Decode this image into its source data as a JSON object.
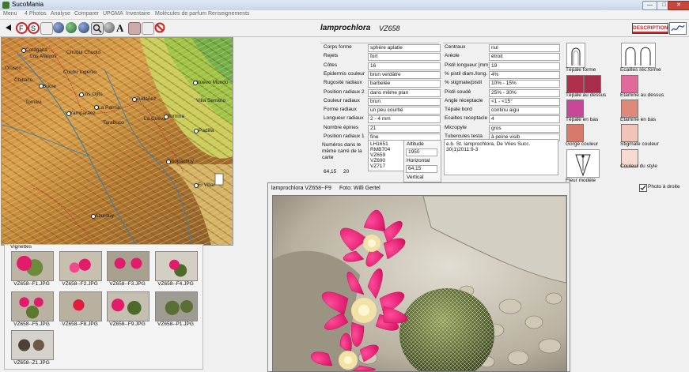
{
  "window": {
    "title": "SucoMania",
    "buttons": [
      "—",
      "□",
      "✕"
    ]
  },
  "menu": [
    "Menu",
    "4 Photos",
    "Analyse",
    "Comparer",
    "UPGMA",
    "Inventaire",
    "Molécules de parfum",
    "Renseignements"
  ],
  "header": {
    "species": "lamprochlora",
    "code": "VZ658",
    "description_button": "DESCRIPTION"
  },
  "map": {
    "labels": [
      "Cotagaita",
      "Los Alamos",
      "Chuqui Chuqui",
      "Cuchu Ingenio",
      "Orúsco",
      "Chillaco",
      "Sucre",
      "Los Ojito",
      "Tomavi",
      "La Palma",
      "Yamparaez",
      "Tarabuco",
      "Zudañez",
      "Nuevo Mundo",
      "La Cueva",
      "Tomina",
      "Villa Serrano",
      "Padilla",
      "Sopachuy",
      "El Villar",
      "Azurduy"
    ]
  },
  "vignettes": {
    "title": "Vignettes",
    "items": [
      "VZ658--F1.JPG",
      "VZ658--F2.JPG",
      "VZ658--F3.JPG",
      "VZ658--F4.JPG",
      "VZ658--F5.JPG",
      "VZ658--F8.JPG",
      "VZ658--F9.JPG",
      "VZ658--P1.JPG",
      "VZ658--Z1.JPG"
    ]
  },
  "form": {
    "left": [
      {
        "label": "Corps forme",
        "value": "sphère aplatie"
      },
      {
        "label": "Rejets",
        "value": "fort"
      },
      {
        "label": "Côtes",
        "value": "16"
      },
      {
        "label": "Epidermis couleur",
        "value": "brun verdâtre"
      },
      {
        "label": "Rugosité radiaux",
        "value": "barbelée"
      },
      {
        "label": "Position radiaux 2",
        "value": "dans même plan"
      },
      {
        "label": "Couleur radiaux",
        "value": "brun"
      },
      {
        "label": "Forme radiaux",
        "value": "un peu courbé"
      },
      {
        "label": "Longueur radiaux",
        "value": "2 - 4 mm"
      },
      {
        "label": "Nombre épines",
        "value": "21"
      },
      {
        "label": "Position radiaux 1",
        "value": "fine"
      }
    ],
    "right": [
      {
        "label": "Centraux",
        "value": "nul"
      },
      {
        "label": "Aréole",
        "value": "étroit"
      },
      {
        "label": "Pistil longueur [mm]",
        "value": "19"
      },
      {
        "label": "% pistil diam./long.",
        "value": "4%"
      },
      {
        "label": "% stigmate/pistil",
        "value": "10% - 15%"
      },
      {
        "label": "Pistil soudé",
        "value": "25% - 30%"
      },
      {
        "label": "Angle réceptacle",
        "value": "<1 - <15°"
      },
      {
        "label": "Tépale bord",
        "value": "continu aigu"
      },
      {
        "label": "Ecailles receptacle",
        "value": "4"
      },
      {
        "label": "Micropyle",
        "value": "gros"
      },
      {
        "label": "Tubercules testa",
        "value": "à peine visib"
      }
    ],
    "numbers_label": "Numéros dans le même carré de la carte",
    "numbers": [
      "LH1651",
      "RMB704",
      "VZ659",
      "VZ690",
      "VZ717"
    ],
    "coords": {
      "a": "64,15",
      "b": "20"
    },
    "altitude": {
      "label": "Altitude",
      "value": "1950"
    },
    "horizontal": {
      "label": "Horizontal",
      "value": "64,15"
    },
    "vertical": {
      "label": "Vertical"
    },
    "reference": "e.b. St. lamprochlora, De Vries Succ. 30(1)2011:9-3"
  },
  "swatches": [
    {
      "label": "Tépale forme"
    },
    {
      "label": "Ecailles réc.forme"
    },
    {
      "label": "Tépale au dessus",
      "color": "#b0304c"
    },
    {
      "label": "Etamine au dessus",
      "color": "#e06a9a"
    },
    {
      "label": "Tépale en bas",
      "color": "#c9479a"
    },
    {
      "label": "Etamine en bas",
      "color": "#e0897a"
    },
    {
      "label": "Gorge couleur",
      "color": "#d77a6a"
    },
    {
      "label": "Stigmate couleur",
      "color": "#f0c4b8"
    },
    {
      "label": "Couleur du style",
      "color": "#f6dad0"
    },
    {
      "label": "Fleur modèle"
    }
  ],
  "photo_toggle": {
    "label": "Photo à droite",
    "checked": true
  },
  "photo_window": {
    "caption": "lamprochlora VZ658--F9",
    "author": "Foto: Willi Gertel"
  },
  "colors": {
    "accent_red": "#d22222",
    "flower_pink": "#e8166e"
  }
}
